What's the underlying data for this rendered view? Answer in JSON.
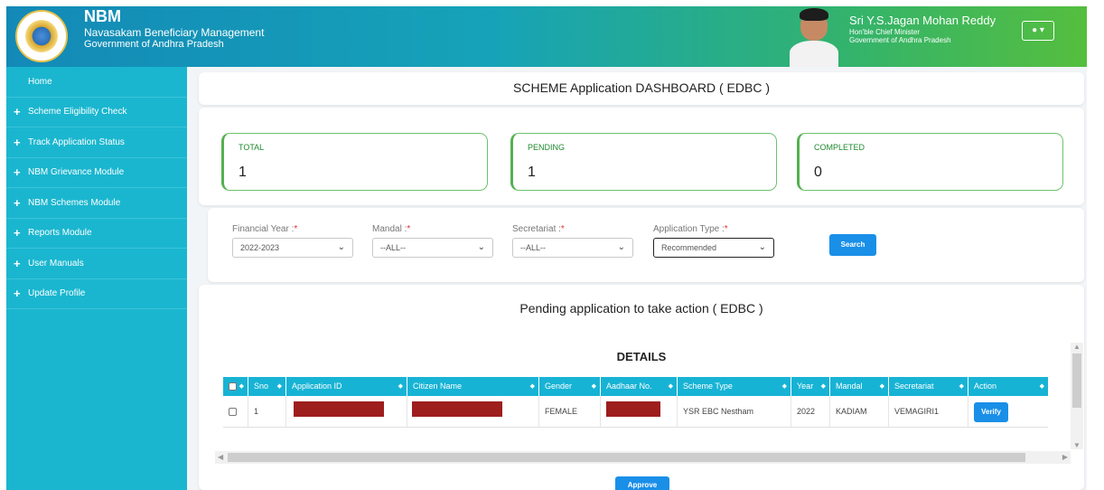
{
  "header": {
    "app_title": "NBM",
    "app_subtitle": "Navasakam Beneficiary Management",
    "app_org": "Government of Andhra Pradesh",
    "cm_name": "Sri Y.S.Jagan Mohan Reddy",
    "cm_title": "Hon'ble Chief Minister",
    "cm_org": "Government of Andhra Pradesh"
  },
  "sidebar": {
    "items": [
      {
        "label": "Home"
      },
      {
        "label": "Scheme Eligibility Check"
      },
      {
        "label": "Track Application Status"
      },
      {
        "label": "NBM Grievance Module"
      },
      {
        "label": "NBM Schemes Module"
      },
      {
        "label": "Reports Module"
      },
      {
        "label": "User Manuals"
      },
      {
        "label": "Update Profile"
      }
    ]
  },
  "dashboard": {
    "title": "SCHEME Application DASHBOARD ( EDBC )",
    "stats": [
      {
        "label": "TOTAL",
        "value": "1"
      },
      {
        "label": "PENDING",
        "value": "1"
      },
      {
        "label": "COMPLETED",
        "value": "0"
      }
    ]
  },
  "filters": {
    "financial_year": {
      "label": "Financial Year :",
      "value": "2022-2023"
    },
    "mandal": {
      "label": "Mandal :",
      "value": "--ALL--"
    },
    "secretariat": {
      "label": "Secretariat :",
      "value": "--ALL--"
    },
    "application_type": {
      "label": "Application Type :",
      "value": "Recommended"
    },
    "required_mark": "*",
    "search_label": "Search"
  },
  "pending": {
    "title": "Pending application to take action ( EDBC )",
    "details_heading": "DETAILS",
    "columns": [
      "Sno",
      "Application ID",
      "Citizen Name",
      "Gender",
      "Aadhaar No.",
      "Scheme Type",
      "Year",
      "Mandal",
      "Secretariat",
      "Action"
    ],
    "row": {
      "sno": "1",
      "gender": "FEMALE",
      "scheme_type": "YSR EBC Nestham",
      "year": "2022",
      "mandal": "KADIAM",
      "secretariat": "VEMAGIRI1",
      "action_label": "Verify"
    },
    "approve_label": "Approve"
  },
  "colors": {
    "sidebar": "#1ab6cf",
    "table_header": "#17b3d5",
    "primary_button": "#1a8fe8",
    "stat_border": "#55b050",
    "redaction": "#9e1d1d"
  },
  "icons": {
    "sidebar_item": "plus-icon",
    "user_menu": "user-icon",
    "select": "chevron-down-icon",
    "sort": "sort-icon"
  }
}
